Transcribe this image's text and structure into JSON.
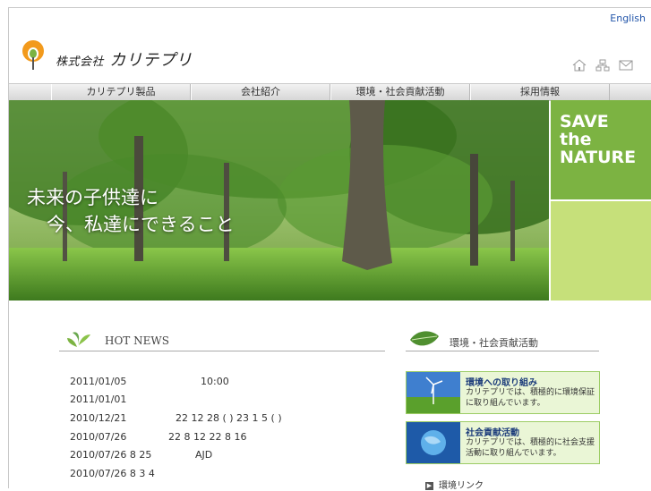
{
  "header": {
    "lang_link": "English",
    "company_prefix": "株式会社",
    "company_name": "カリテプリ",
    "utility_icons": [
      "home-icon",
      "sitemap-icon",
      "mail-icon"
    ]
  },
  "nav": {
    "items": [
      "カリテプリ製品",
      "会社紹介",
      "環境・社会貢献活動",
      "採用情報"
    ]
  },
  "hero": {
    "line1": "未来の子供達に",
    "line2": "今、私達にできること"
  },
  "save_box": {
    "line1": "SAVE",
    "line2": "the",
    "line3": "NATURE"
  },
  "hot_news": {
    "title": "HOT NEWS",
    "rows": [
      {
        "date": "2011/01/05",
        "text": "10:00"
      },
      {
        "date": "2011/01/01",
        "text": ""
      },
      {
        "date": "2010/12/21",
        "text": "22 12 28 ( )     23 1 5 ( )"
      },
      {
        "date": "2010/07/26",
        "text": "22 8 12     22 8 16"
      },
      {
        "date": "2010/07/26 8 25",
        "text": "AJD"
      },
      {
        "date": "2010/07/26 8 3   4",
        "text": ""
      }
    ]
  },
  "activities": {
    "title": "環境・社会貢献活動",
    "banners": [
      {
        "title": "環境への取り組み",
        "desc": "カリテプリでは、積極的に環境保証に取り組んでいます。"
      },
      {
        "title": "社会貢献活動",
        "desc": "カリテプリでは、積極的に社会支援活動に取り組んでいます。"
      }
    ],
    "link": "環境リンク"
  },
  "colors": {
    "accent_green": "#7cb342",
    "light_green": "#c6e07a",
    "link_blue": "#2255aa"
  }
}
